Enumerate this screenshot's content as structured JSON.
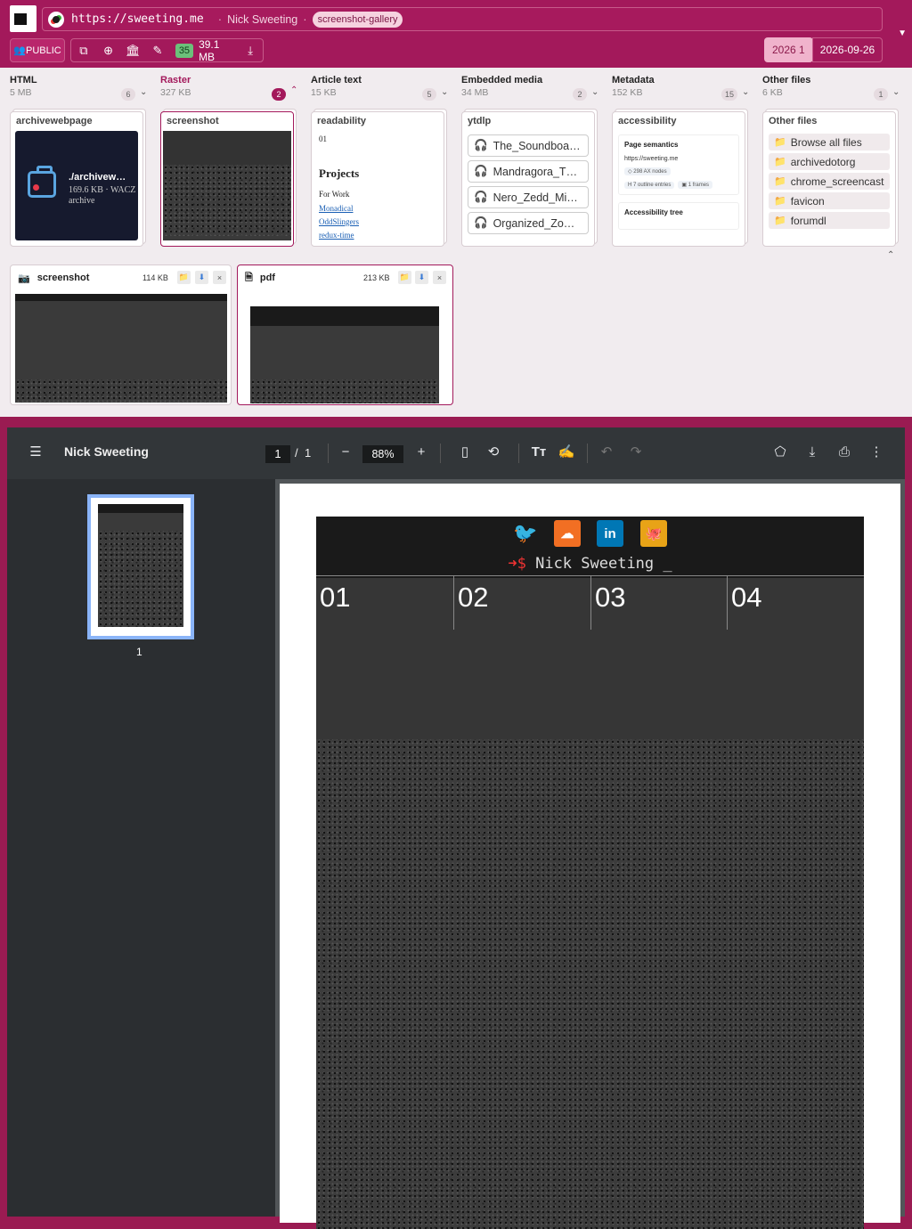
{
  "header": {
    "url": "https://sweeting.me",
    "title": "Nick Sweeting",
    "tag": "screenshot-gallery",
    "public_label": "👥PUBLIC",
    "count": "35",
    "size": "39.1 MB",
    "year": "2026",
    "year_count": "1",
    "date": "2026-09-26"
  },
  "columns": [
    {
      "name": "HTML",
      "size": "5 MB",
      "count": "6"
    },
    {
      "name": "Raster",
      "size": "327 KB",
      "count": "2"
    },
    {
      "name": "Article text",
      "size": "15 KB",
      "count": "5"
    },
    {
      "name": "Embedded media",
      "size": "34 MB",
      "count": "2"
    },
    {
      "name": "Metadata",
      "size": "152 KB",
      "count": "15"
    },
    {
      "name": "Other files",
      "size": "6 KB",
      "count": "1"
    }
  ],
  "cards": {
    "archivewebpage": {
      "title": "archivewebpage",
      "file": "./archivew…",
      "meta": "169.6 KB · WACZ",
      "type": "archive"
    },
    "screenshot": {
      "title": "screenshot"
    },
    "readability": {
      "title": "readability",
      "num": "01",
      "heading": "Projects",
      "sub": "For Work",
      "links": [
        "Monadical",
        "OddSlingers",
        "redux-time"
      ]
    },
    "ytdlp": {
      "title": "ytdlp",
      "items": [
        "The_Soundboa…",
        "Mandragora_T…",
        "Nero_Zedd_Mi…",
        "Organized_Zo…"
      ]
    },
    "accessibility": {
      "title": "accessibility",
      "sec1": "Page semantics",
      "url": "https://sweeting.me",
      "chip1": "◇ 298 AX nodes",
      "chip2": "H 7 outline entries",
      "chip3": "▣ 1 frames",
      "sec2": "Accessibility tree"
    },
    "other": {
      "title": "Other files",
      "items": [
        "Browse all files",
        "archivedotorg",
        "chrome_screencast",
        "favicon",
        "forumdl"
      ]
    }
  },
  "previews": [
    {
      "name": "screenshot",
      "size": "114 KB"
    },
    {
      "name": "pdf",
      "size": "213 KB"
    }
  ],
  "viewer": {
    "title": "Nick Sweeting",
    "page": "1",
    "total": "1",
    "zoom": "88%",
    "thumb_label": "1"
  },
  "site": {
    "prompt": "➜$",
    "name": "Nick Sweeting _",
    "tabs": [
      "01",
      "02",
      "03",
      "04"
    ]
  }
}
